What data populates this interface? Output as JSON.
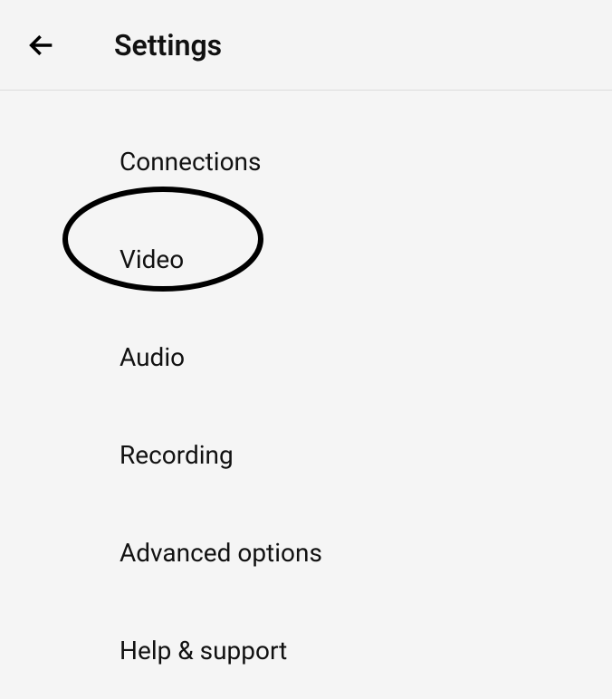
{
  "header": {
    "title": "Settings"
  },
  "menu": {
    "items": [
      {
        "label": "Connections"
      },
      {
        "label": "Video"
      },
      {
        "label": "Audio"
      },
      {
        "label": "Recording"
      },
      {
        "label": "Advanced options"
      },
      {
        "label": "Help & support"
      }
    ]
  }
}
